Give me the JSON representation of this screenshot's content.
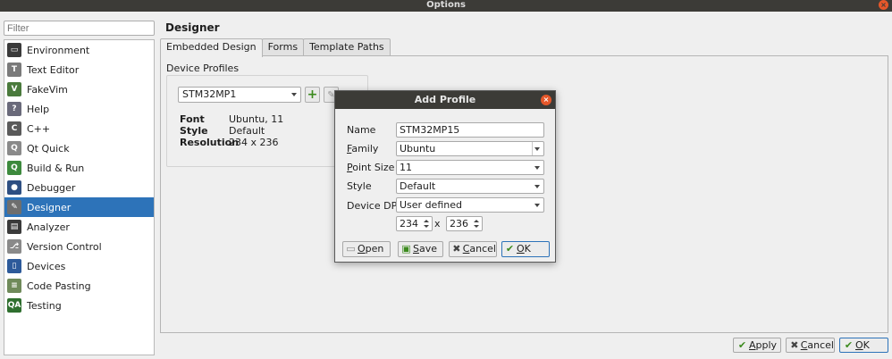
{
  "window": {
    "title": "Options",
    "close_glyph": "×"
  },
  "filter": {
    "placeholder": "Filter"
  },
  "sidebar": {
    "items": [
      {
        "label": "Environment",
        "icon": "monitor-icon",
        "color": "#3a3a3a",
        "glyph": "▭"
      },
      {
        "label": "Text Editor",
        "icon": "text-editor-icon",
        "color": "#7a7a7a",
        "glyph": "T"
      },
      {
        "label": "FakeVim",
        "icon": "vim-icon",
        "color": "#4a7a3c",
        "glyph": "V"
      },
      {
        "label": "Help",
        "icon": "help-icon",
        "color": "#6a6a7a",
        "glyph": "?"
      },
      {
        "label": "C++",
        "icon": "cpp-icon",
        "color": "#5a5a5a",
        "glyph": "C"
      },
      {
        "label": "Qt Quick",
        "icon": "qt-quick-icon",
        "color": "#8a8a8a",
        "glyph": "Q"
      },
      {
        "label": "Build & Run",
        "icon": "build-run-icon",
        "color": "#3d8a3d",
        "glyph": "Q"
      },
      {
        "label": "Debugger",
        "icon": "debugger-icon",
        "color": "#2e4f82",
        "glyph": "●"
      },
      {
        "label": "Designer",
        "icon": "designer-icon",
        "color": "#6e6e6e",
        "glyph": "✎",
        "selected": true
      },
      {
        "label": "Analyzer",
        "icon": "analyzer-icon",
        "color": "#3a3a3a",
        "glyph": "▤"
      },
      {
        "label": "Version Control",
        "icon": "version-control-icon",
        "color": "#8a8a8a",
        "glyph": "⎇"
      },
      {
        "label": "Devices",
        "icon": "devices-icon",
        "color": "#2d5a9a",
        "glyph": "▯"
      },
      {
        "label": "Code Pasting",
        "icon": "code-pasting-icon",
        "color": "#6f8a5a",
        "glyph": "≡"
      },
      {
        "label": "Testing",
        "icon": "testing-icon",
        "color": "#2f6f2f",
        "glyph": "QA"
      }
    ]
  },
  "main": {
    "heading": "Designer",
    "tabs": [
      {
        "label": "Embedded Design",
        "active": true
      },
      {
        "label": "Forms"
      },
      {
        "label": "Template Paths"
      }
    ],
    "group_label": "Device Profiles",
    "profile": "STM32MP1",
    "add_glyph": "+",
    "edit_glyph": "✎",
    "props": {
      "font_key": "Font",
      "font_val": "Ubuntu, 11",
      "style_key": "Style",
      "style_val": "Default",
      "resolution_key": "Resolution",
      "resolution_val": "234 x 236"
    }
  },
  "dialog": {
    "title": "Add Profile",
    "close_glyph": "×",
    "name_label": "Name",
    "name_value": "STM32MP15",
    "family_label_u": "F",
    "family_label_rest": "amily",
    "family_value": "Ubuntu",
    "pointsize_label_u": "P",
    "pointsize_label_rest": "oint Size",
    "pointsize_value": "11",
    "style_label": "Style",
    "style_value": "Default",
    "dpi_label": "Device DPI",
    "dpi_value": "User defined",
    "width": "234",
    "x_sep": "x",
    "height": "236",
    "buttons": {
      "open_u": "O",
      "open_rest": "pen",
      "open_glyph": "▭",
      "save_u": "S",
      "save_rest": "ave",
      "save_glyph": "▣",
      "cancel_u": "C",
      "cancel_rest": "ancel",
      "cancel_glyph": "✖",
      "ok_u": "O",
      "ok_rest": "K",
      "ok_glyph": "✔"
    }
  },
  "footer": {
    "apply_u": "A",
    "apply_rest": "pply",
    "apply_glyph": "✔",
    "cancel_u": "C",
    "cancel_rest": "ancel",
    "cancel_glyph": "✖",
    "ok_u": "O",
    "ok_rest": "K",
    "ok_glyph": "✔"
  },
  "colors": {
    "accent": "#2d73b9",
    "check": "#3c8a1e",
    "titlebar": "#3c3b37",
    "close": "#e5572a"
  }
}
